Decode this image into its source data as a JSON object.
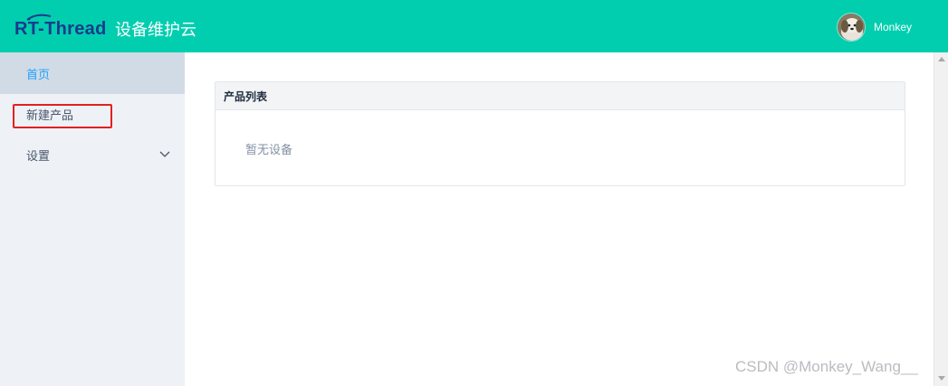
{
  "header": {
    "logo_text": "RT-Thread",
    "app_title": "设备维护云",
    "username": "Monkey",
    "bg_color": "#00ceaf"
  },
  "sidebar": {
    "items": [
      {
        "label": "首页",
        "active": true
      },
      {
        "label": "新建产品",
        "active": false
      },
      {
        "label": "设置",
        "active": false,
        "icon": "chevron-down-icon"
      }
    ]
  },
  "main": {
    "card": {
      "title": "产品列表",
      "empty_text": "暂无设备"
    }
  },
  "watermark": "CSDN @Monkey_Wang__"
}
